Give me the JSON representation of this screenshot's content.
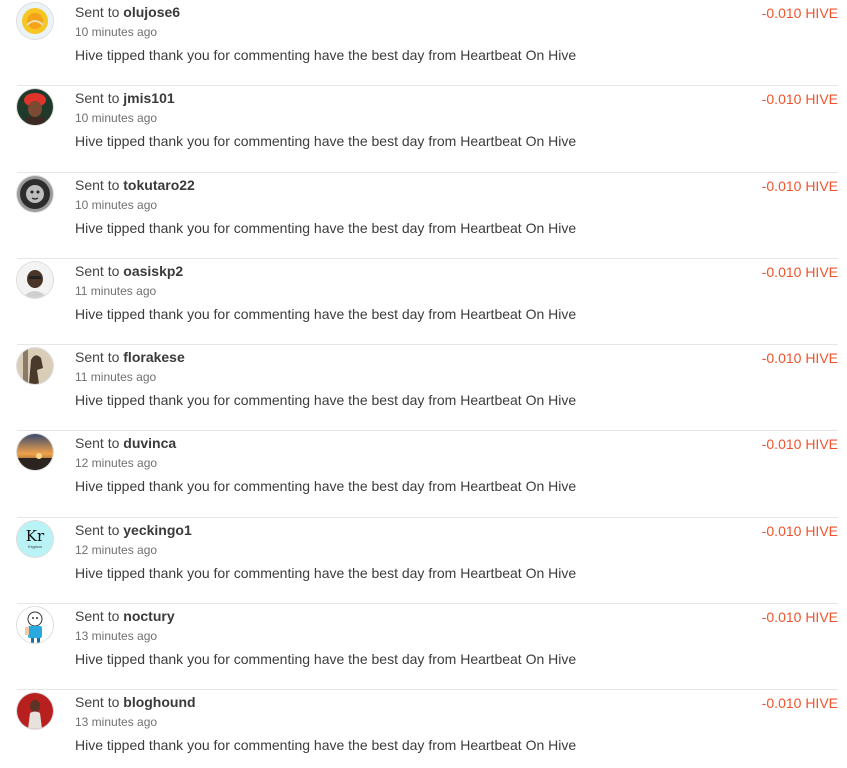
{
  "colors": {
    "amount": "#f0532c",
    "divider": "#e6e6e6"
  },
  "transfers": [
    {
      "prefix": "Sent to",
      "user": "olujose6",
      "time": "10 minutes ago",
      "memo": "Hive tipped thank you for commenting have the best day from Heartbeat On Hive",
      "amount": "-0.010 HIVE",
      "avatar": "yellow-badge-avatar-icon"
    },
    {
      "prefix": "Sent to",
      "user": "jmis101",
      "time": "10 minutes ago",
      "memo": "Hive tipped thank you for commenting have the best day from Heartbeat On Hive",
      "amount": "-0.010 HIVE",
      "avatar": "person-red-headwrap-avatar-icon"
    },
    {
      "prefix": "Sent to",
      "user": "tokutaro22",
      "time": "10 minutes ago",
      "memo": "Hive tipped thank you for commenting have the best day from Heartbeat On Hive",
      "amount": "-0.010 HIVE",
      "avatar": "lion-head-avatar-icon"
    },
    {
      "prefix": "Sent to",
      "user": "oasiskp2",
      "time": "11 minutes ago",
      "memo": "Hive tipped thank you for commenting have the best day from Heartbeat On Hive",
      "amount": "-0.010 HIVE",
      "avatar": "person-portrait-avatar-icon"
    },
    {
      "prefix": "Sent to",
      "user": "florakese",
      "time": "11 minutes ago",
      "memo": "Hive tipped thank you for commenting have the best day from Heartbeat On Hive",
      "amount": "-0.010 HIVE",
      "avatar": "horse-avatar-icon"
    },
    {
      "prefix": "Sent to",
      "user": "duvinca",
      "time": "12 minutes ago",
      "memo": "Hive tipped thank you for commenting have the best day from Heartbeat On Hive",
      "amount": "-0.010 HIVE",
      "avatar": "sunset-avatar-icon"
    },
    {
      "prefix": "Sent to",
      "user": "yeckingo1",
      "time": "12 minutes ago",
      "memo": "Hive tipped thank you for commenting have the best day from Heartbeat On Hive",
      "amount": "-0.010 HIVE",
      "avatar": "krypton-element-avatar-icon",
      "avatar_text": "Kr",
      "avatar_subtext": "Krypton"
    },
    {
      "prefix": "Sent to",
      "user": "noctury",
      "time": "13 minutes ago",
      "memo": "Hive tipped thank you for commenting have the best day from Heartbeat On Hive",
      "amount": "-0.010 HIVE",
      "avatar": "cartoon-character-avatar-icon"
    },
    {
      "prefix": "Sent to",
      "user": "bloghound",
      "time": "13 minutes ago",
      "memo": "Hive tipped thank you for commenting have the best day from Heartbeat On Hive",
      "amount": "-0.010 HIVE",
      "avatar": "person-red-background-avatar-icon"
    }
  ]
}
